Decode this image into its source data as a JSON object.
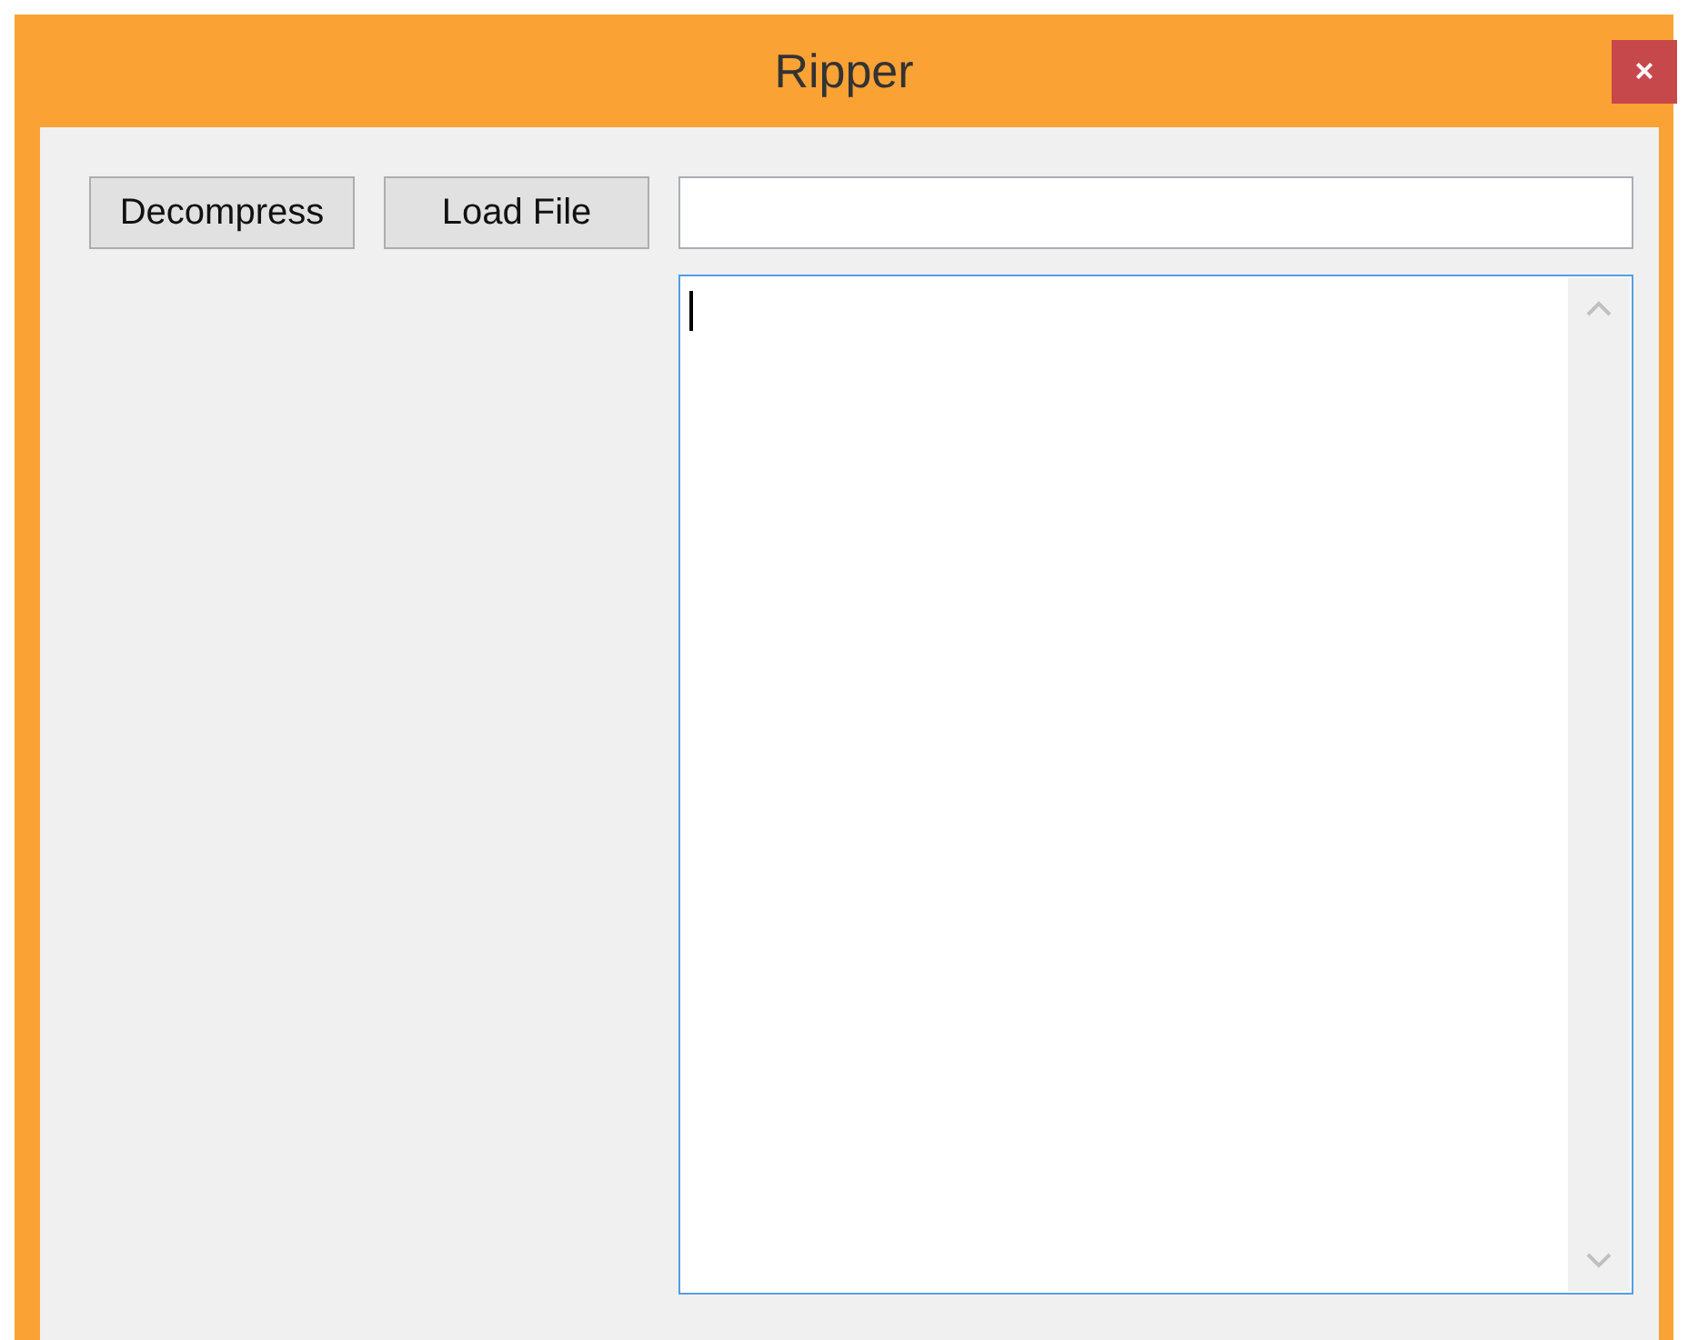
{
  "window": {
    "title": "Ripper",
    "close": "×"
  },
  "buttons": [
    {
      "label": "Decompress"
    },
    {
      "label": "Load File"
    }
  ],
  "path_field": {
    "focused": false
  },
  "output_area": {
    "focused": true
  }
}
